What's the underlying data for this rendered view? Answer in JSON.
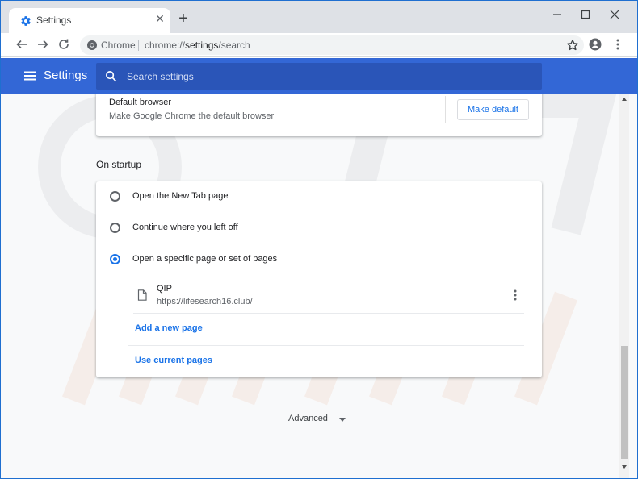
{
  "tab": {
    "title": "Settings",
    "favicon": "gear-icon"
  },
  "window_controls": [
    "minimize-icon",
    "maximize-icon",
    "close-icon"
  ],
  "omnibox": {
    "chip": "Chrome",
    "url_scheme": "chrome://",
    "url_host": "settings",
    "url_path": "/search"
  },
  "header": {
    "title": "Settings",
    "search_placeholder": "Search settings"
  },
  "default_browser": {
    "title": "Default browser",
    "subtitle": "Make Google Chrome the default browser",
    "button": "Make default"
  },
  "startup": {
    "section_title": "On startup",
    "options": [
      {
        "label": "Open the New Tab page",
        "checked": false
      },
      {
        "label": "Continue where you left off",
        "checked": false
      },
      {
        "label": "Open a specific page or set of pages",
        "checked": true
      }
    ],
    "pages": [
      {
        "name": "QIP",
        "url": "https://lifesearch16.club/"
      }
    ],
    "add_page": "Add a new page",
    "use_current": "Use current pages"
  },
  "advanced_label": "Advanced",
  "colors": {
    "header_blue": "#3367d6",
    "accent": "#1a73e8"
  }
}
